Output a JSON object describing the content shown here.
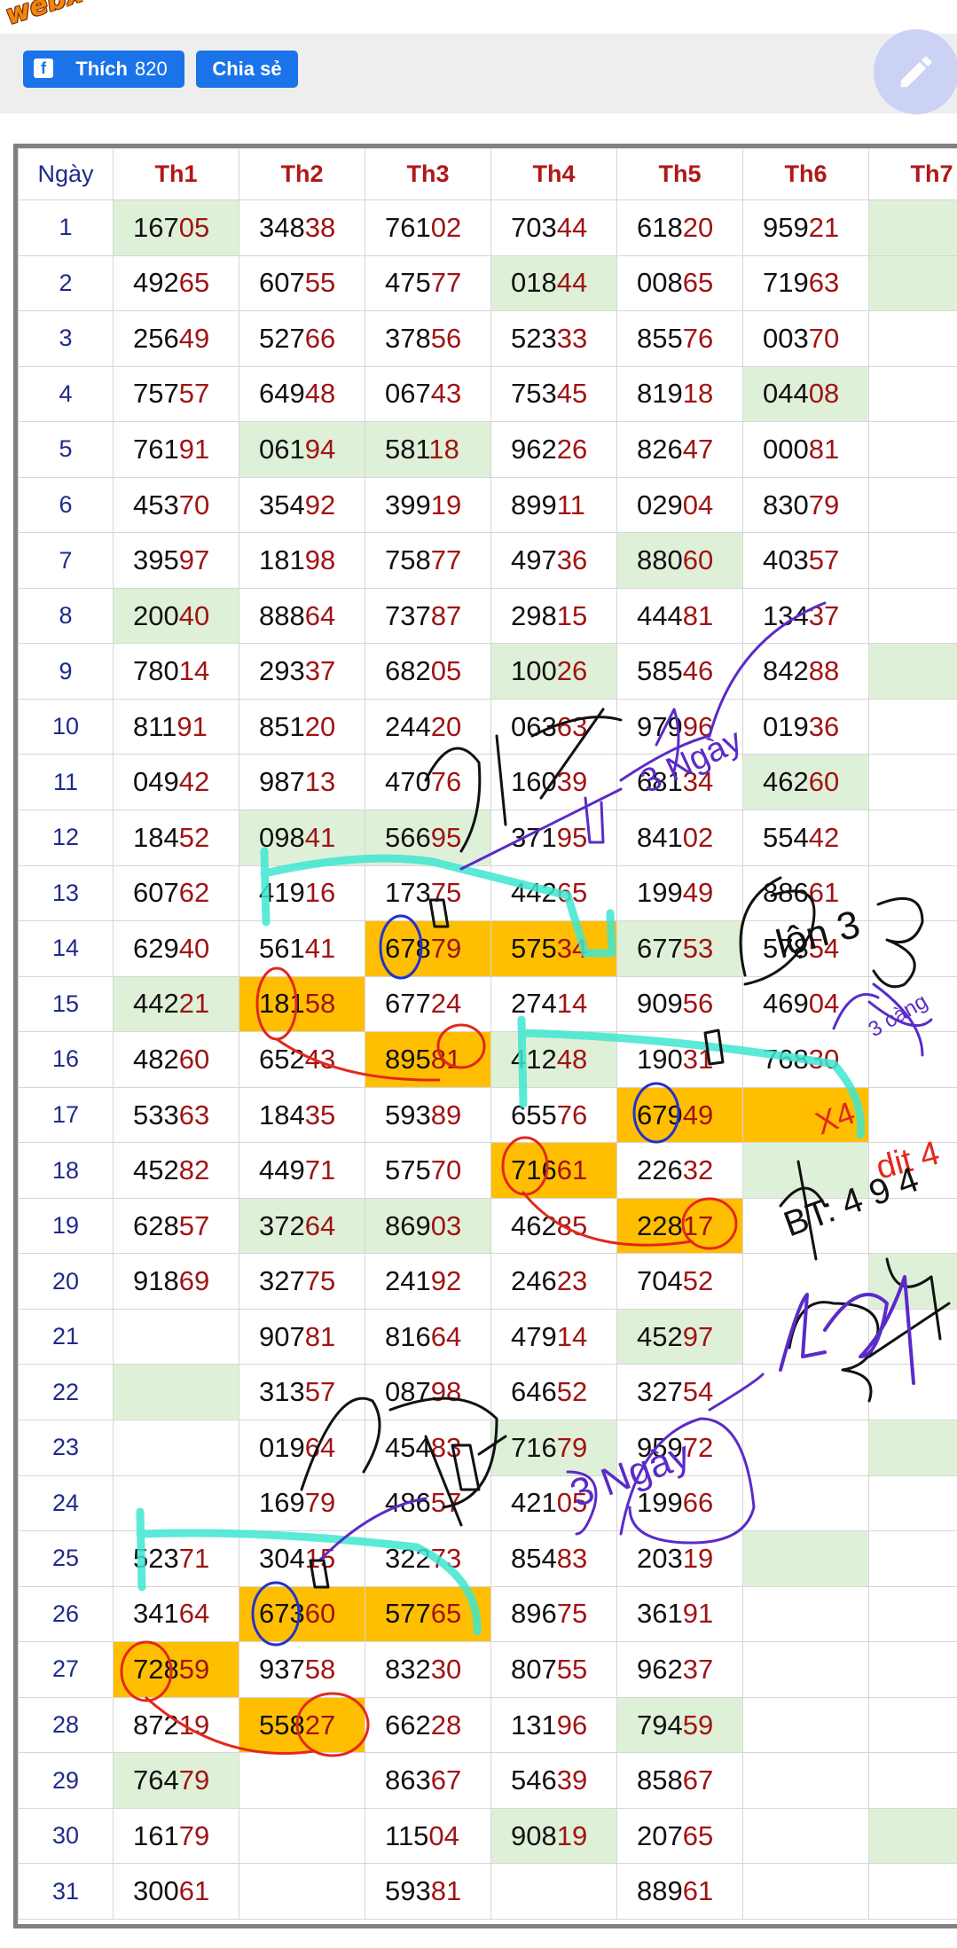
{
  "logo_text": "webxoso.net",
  "toolbar": {
    "like_label": "Thích",
    "like_count": "820",
    "share_label": "Chia sẻ",
    "fab_icon": "pencil-icon"
  },
  "table": {
    "headers": [
      "Ngày",
      "Th1",
      "Th2",
      "Th3",
      "Th4",
      "Th5",
      "Th6",
      "Th7"
    ],
    "rows": [
      {
        "day": "1",
        "cells": [
          "16705",
          "34838",
          "76102",
          "70344",
          "61820",
          "95921",
          ""
        ],
        "hl": [
          "g",
          "",
          "",
          "",
          "",
          "",
          "g"
        ]
      },
      {
        "day": "2",
        "cells": [
          "49265",
          "60755",
          "47577",
          "01844",
          "00865",
          "71963",
          ""
        ],
        "hl": [
          "",
          "",
          "",
          "g",
          "",
          "",
          "g"
        ]
      },
      {
        "day": "3",
        "cells": [
          "25649",
          "52766",
          "37856",
          "52333",
          "85576",
          "00370",
          ""
        ],
        "hl": [
          "",
          "",
          "",
          "",
          "",
          "",
          ""
        ]
      },
      {
        "day": "4",
        "cells": [
          "75757",
          "64948",
          "06743",
          "75345",
          "81918",
          "04408",
          ""
        ],
        "hl": [
          "",
          "",
          "",
          "",
          "",
          "g",
          ""
        ]
      },
      {
        "day": "5",
        "cells": [
          "76191",
          "06194",
          "58118",
          "96226",
          "82647",
          "00081",
          ""
        ],
        "hl": [
          "",
          "g",
          "g",
          "",
          "",
          "",
          ""
        ]
      },
      {
        "day": "6",
        "cells": [
          "45370",
          "35492",
          "39919",
          "89911",
          "02904",
          "83079",
          ""
        ],
        "hl": [
          "",
          "",
          "",
          "",
          "",
          "",
          ""
        ]
      },
      {
        "day": "7",
        "cells": [
          "39597",
          "18198",
          "75877",
          "49736",
          "88060",
          "40357",
          ""
        ],
        "hl": [
          "",
          "",
          "",
          "",
          "g",
          "",
          ""
        ]
      },
      {
        "day": "8",
        "cells": [
          "20040",
          "88864",
          "73787",
          "29815",
          "44481",
          "13437",
          ""
        ],
        "hl": [
          "g",
          "",
          "",
          "",
          "",
          "",
          ""
        ]
      },
      {
        "day": "9",
        "cells": [
          "78014",
          "29337",
          "68205",
          "10026",
          "58546",
          "84288",
          ""
        ],
        "hl": [
          "",
          "",
          "",
          "g",
          "",
          "",
          "g"
        ]
      },
      {
        "day": "10",
        "cells": [
          "81191",
          "85120",
          "24420",
          "06363",
          "97996",
          "01936",
          ""
        ],
        "hl": [
          "",
          "",
          "",
          "",
          "",
          "",
          ""
        ]
      },
      {
        "day": "11",
        "cells": [
          "04942",
          "98713",
          "47076",
          "16039",
          "68134",
          "46260",
          ""
        ],
        "hl": [
          "",
          "",
          "",
          "",
          "",
          "g",
          ""
        ]
      },
      {
        "day": "12",
        "cells": [
          "18452",
          "09841",
          "56695",
          "37195",
          "84102",
          "55442",
          ""
        ],
        "hl": [
          "",
          "g",
          "g",
          "",
          "",
          "",
          ""
        ]
      },
      {
        "day": "13",
        "cells": [
          "60762",
          "41916",
          "17375",
          "44265",
          "19949",
          "88661",
          ""
        ],
        "hl": [
          "",
          "",
          "",
          "",
          "",
          "",
          ""
        ]
      },
      {
        "day": "14",
        "cells": [
          "62940",
          "56141",
          "67879",
          "57534",
          "67753",
          "57854",
          ""
        ],
        "hl": [
          "",
          "",
          "o",
          "o",
          "g",
          "",
          ""
        ]
      },
      {
        "day": "15",
        "cells": [
          "44221",
          "18158",
          "67724",
          "27414",
          "90956",
          "46904",
          ""
        ],
        "hl": [
          "g",
          "o",
          "",
          "",
          "",
          "",
          ""
        ]
      },
      {
        "day": "16",
        "cells": [
          "48260",
          "65243",
          "89581",
          "41248",
          "19031",
          "76830",
          ""
        ],
        "hl": [
          "",
          "",
          "o",
          "g",
          "",
          "",
          ""
        ]
      },
      {
        "day": "17",
        "cells": [
          "53363",
          "18435",
          "59389",
          "65576",
          "67949",
          "",
          ""
        ],
        "hl": [
          "",
          "",
          "",
          "",
          "o",
          "o",
          ""
        ]
      },
      {
        "day": "18",
        "cells": [
          "45282",
          "44971",
          "57570",
          "71661",
          "22632",
          "",
          ""
        ],
        "hl": [
          "",
          "",
          "",
          "o",
          "",
          "g",
          ""
        ]
      },
      {
        "day": "19",
        "cells": [
          "62857",
          "37264",
          "86903",
          "46285",
          "22817",
          "",
          ""
        ],
        "hl": [
          "",
          "g",
          "g",
          "",
          "o",
          "",
          ""
        ]
      },
      {
        "day": "20",
        "cells": [
          "91869",
          "32775",
          "24192",
          "24623",
          "70452",
          "",
          ""
        ],
        "hl": [
          "",
          "",
          "",
          "",
          "",
          "",
          "g"
        ]
      },
      {
        "day": "21",
        "cells": [
          "",
          "90781",
          "81664",
          "47914",
          "45297",
          "",
          ""
        ],
        "hl": [
          "",
          "",
          "",
          "",
          "g",
          "",
          ""
        ]
      },
      {
        "day": "22",
        "cells": [
          "",
          "31357",
          "08798",
          "64652",
          "32754",
          "",
          ""
        ],
        "hl": [
          "g",
          "",
          "",
          "",
          "",
          "",
          ""
        ]
      },
      {
        "day": "23",
        "cells": [
          "",
          "01964",
          "45483",
          "71679",
          "95972",
          "",
          ""
        ],
        "hl": [
          "",
          "",
          "",
          "g",
          "",
          "",
          "g"
        ]
      },
      {
        "day": "24",
        "cells": [
          "",
          "16979",
          "48657",
          "42105",
          "19966",
          "",
          ""
        ],
        "hl": [
          "",
          "",
          "",
          "",
          "",
          "",
          ""
        ]
      },
      {
        "day": "25",
        "cells": [
          "52371",
          "30415",
          "32273",
          "85483",
          "20319",
          "",
          ""
        ],
        "hl": [
          "",
          "",
          "",
          "",
          "",
          "g",
          ""
        ]
      },
      {
        "day": "26",
        "cells": [
          "34164",
          "67360",
          "57765",
          "89675",
          "36191",
          "",
          ""
        ],
        "hl": [
          "",
          "o",
          "o",
          "",
          "",
          "",
          ""
        ]
      },
      {
        "day": "27",
        "cells": [
          "72859",
          "93758",
          "83230",
          "80755",
          "96237",
          "",
          ""
        ],
        "hl": [
          "o",
          "",
          "",
          "",
          "",
          "",
          ""
        ]
      },
      {
        "day": "28",
        "cells": [
          "87219",
          "55827",
          "66228",
          "13196",
          "79459",
          "",
          ""
        ],
        "hl": [
          "",
          "o",
          "",
          "",
          "g",
          "",
          ""
        ]
      },
      {
        "day": "29",
        "cells": [
          "76479",
          "",
          "86367",
          "54639",
          "85867",
          "",
          ""
        ],
        "hl": [
          "g",
          "",
          "",
          "",
          "",
          "",
          ""
        ]
      },
      {
        "day": "30",
        "cells": [
          "16179",
          "",
          "11504",
          "90819",
          "20765",
          "",
          ""
        ],
        "hl": [
          "",
          "",
          "",
          "g",
          "",
          "",
          "g"
        ]
      },
      {
        "day": "31",
        "cells": [
          "30061",
          "",
          "59381",
          "",
          "88961",
          "",
          ""
        ],
        "hl": [
          "",
          "",
          "",
          "",
          "",
          "",
          ""
        ]
      }
    ]
  },
  "annotations": {
    "notes": [
      "3 Ngày",
      "lộn 3",
      "3 càng",
      "X4",
      "dit 4",
      "BT: 4 9 4",
      "3 Ngày"
    ]
  },
  "colors": {
    "green": "#dff0d8",
    "orange": "#ffbf00",
    "button": "#1a73e8",
    "header": "#b01818",
    "day": "#1f2a8a"
  }
}
